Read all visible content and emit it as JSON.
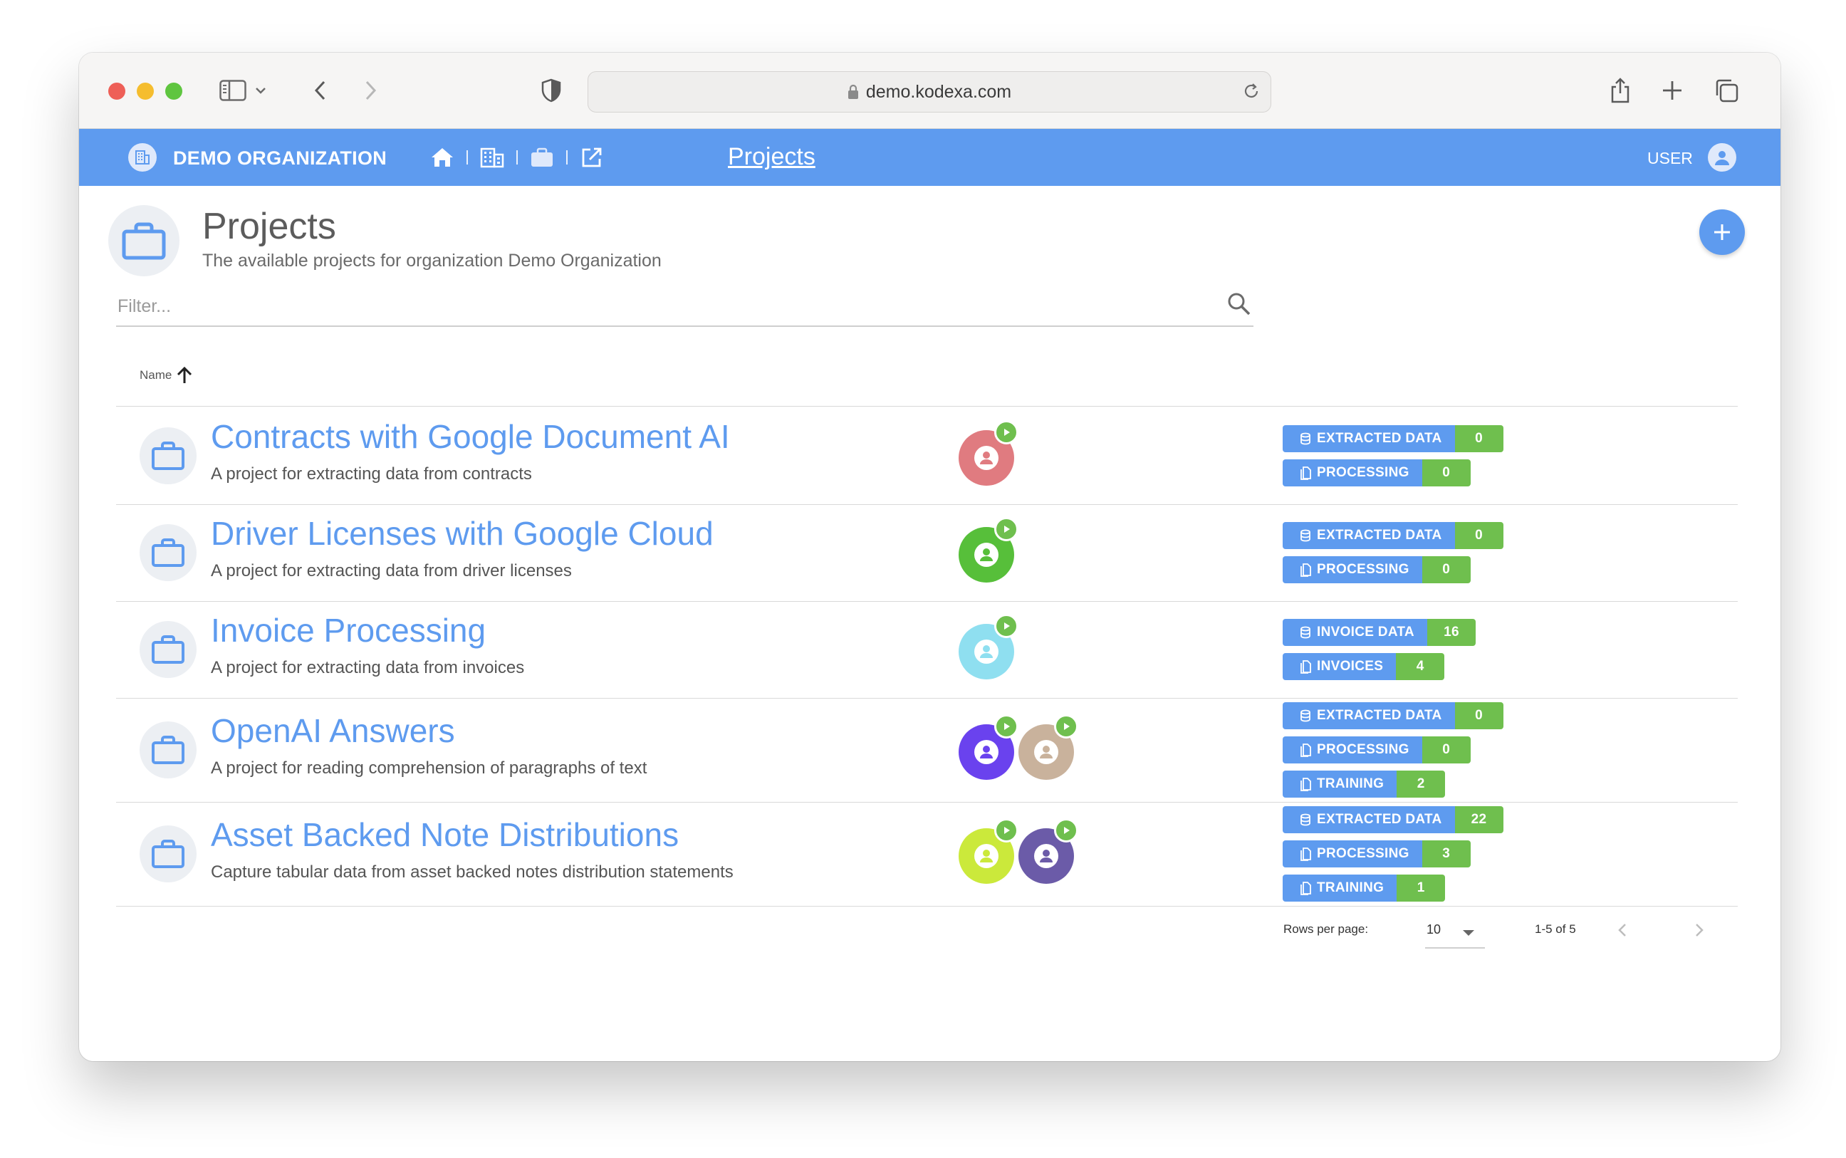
{
  "browser": {
    "url": "demo.kodexa.com"
  },
  "appbar": {
    "org_name": "DEMO ORGANIZATION",
    "title": "Projects",
    "user_label": "USER"
  },
  "page": {
    "title": "Projects",
    "subtitle": "The available projects for organization Demo Organization"
  },
  "filter": {
    "placeholder": "Filter..."
  },
  "table": {
    "sort_column": "Name",
    "sort_direction": "ascending",
    "rows": [
      {
        "title": "Contracts with Google Document AI",
        "description": "A project for extracting data from contracts",
        "assistants": [
          "#e07b80"
        ],
        "badges": [
          {
            "label": "EXTRACTED DATA",
            "count": "0",
            "icon": "database-icon"
          },
          {
            "label": "PROCESSING",
            "count": "0",
            "icon": "document-icon"
          }
        ]
      },
      {
        "title": "Driver Licenses with Google Cloud",
        "description": "A project for extracting data from driver licenses",
        "assistants": [
          "#57bf3a"
        ],
        "badges": [
          {
            "label": "EXTRACTED DATA",
            "count": "0",
            "icon": "database-icon"
          },
          {
            "label": "PROCESSING",
            "count": "0",
            "icon": "document-icon"
          }
        ]
      },
      {
        "title": "Invoice Processing",
        "description": "A project for extracting data from invoices",
        "assistants": [
          "#8fdff0"
        ],
        "badges": [
          {
            "label": "INVOICE DATA",
            "count": "16",
            "icon": "database-icon"
          },
          {
            "label": "INVOICES",
            "count": "4",
            "icon": "document-icon"
          }
        ]
      },
      {
        "title": "OpenAI Answers",
        "description": "A project for reading comprehension of paragraphs of text",
        "assistants": [
          "#6a42ee",
          "#c9b29c"
        ],
        "badges": [
          {
            "label": "EXTRACTED DATA",
            "count": "0",
            "icon": "database-icon"
          },
          {
            "label": "PROCESSING",
            "count": "0",
            "icon": "document-icon"
          },
          {
            "label": "TRAINING",
            "count": "2",
            "icon": "document-icon"
          }
        ]
      },
      {
        "title": "Asset Backed Note Distributions",
        "description": "Capture tabular data from asset backed notes distribution statements",
        "assistants": [
          "#cbe93b",
          "#6b5ba8"
        ],
        "badges": [
          {
            "label": "EXTRACTED DATA",
            "count": "22",
            "icon": "database-icon"
          },
          {
            "label": "PROCESSING",
            "count": "3",
            "icon": "document-icon"
          },
          {
            "label": "TRAINING",
            "count": "1",
            "icon": "document-icon"
          }
        ]
      }
    ]
  },
  "pagination": {
    "rows_per_page_label": "Rows per page:",
    "rows_per_page_value": "10",
    "range_label": "1-5 of 5"
  },
  "colors": {
    "primary": "#5e9bef",
    "success": "#6fbf4e",
    "title_link": "#5e9bef"
  }
}
